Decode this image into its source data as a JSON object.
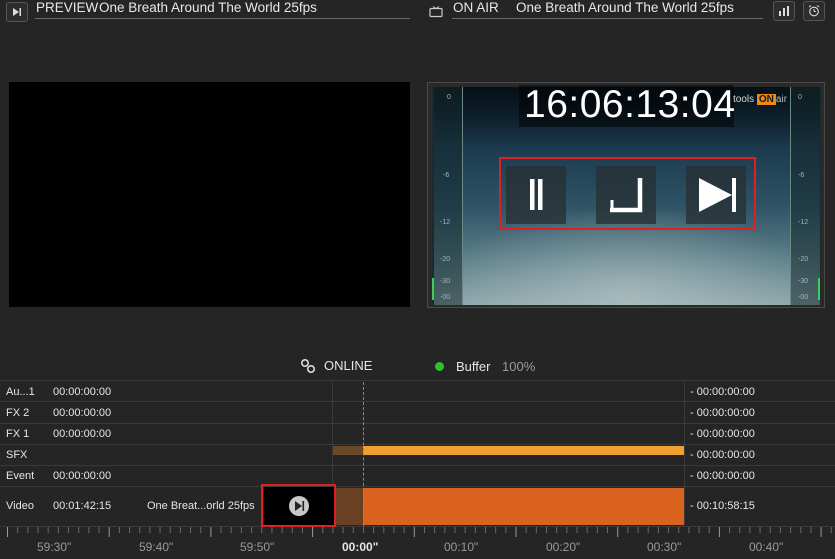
{
  "preview": {
    "label": "PREVIEW",
    "title": "One Breath Around The World 25fps"
  },
  "onair": {
    "label": "ON AIR",
    "title": "One Breath Around The World 25fps",
    "timecode": "16:06:13:04",
    "logo_prefix": "tools",
    "logo_on": "ON",
    "logo_suffix": "air"
  },
  "meter_left": [
    "0",
    "-6",
    "-12",
    "-20",
    "-30",
    "-00"
  ],
  "meter_right": [
    "0",
    "-6",
    "-12",
    "-20",
    "-30",
    "-00"
  ],
  "status": {
    "online": "ONLINE",
    "buffer_label": "Buffer",
    "buffer_value": "100%"
  },
  "tracks": [
    {
      "name": "Au...1",
      "tc": "00:00:00:00",
      "end": "- 00:00:00:00"
    },
    {
      "name": "FX 2",
      "tc": "00:00:00:00",
      "end": "- 00:00:00:00"
    },
    {
      "name": "FX 1",
      "tc": "00:00:00:00",
      "end": "- 00:00:00:00"
    },
    {
      "name": "SFX",
      "tc": "",
      "end": "- 00:00:00:00"
    },
    {
      "name": "Event",
      "tc": "00:00:00:00",
      "end": "- 00:00:00:00"
    },
    {
      "name": "Video",
      "tc": "00:01:42:15",
      "clip": "One Breat...orld 25fps",
      "end": "- 00:10:58:15"
    }
  ],
  "ruler": [
    "59:30\"",
    "59:40\"",
    "59:50\"",
    "00:00\"",
    "00:10\"",
    "00:20\"",
    "00:30\"",
    "00:40\""
  ],
  "colors": {
    "sfx": "#f0a030",
    "video": "#d8621e",
    "highlight": "#e02020",
    "online_dot": "#2ec02e"
  }
}
